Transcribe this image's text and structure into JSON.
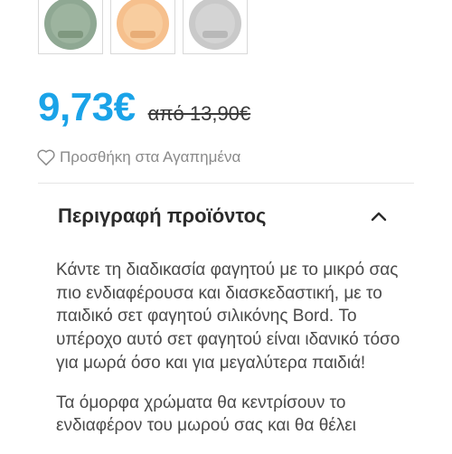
{
  "swatches": [
    {
      "name": "green",
      "color": "#8fa893"
    },
    {
      "name": "orange",
      "color": "#f6c08d"
    },
    {
      "name": "grey",
      "color": "#c9c9c9"
    }
  ],
  "price": {
    "current": "9,73€",
    "old": "από 13,90€"
  },
  "wishlist": {
    "label": "Προσθήκη στα Αγαπημένα"
  },
  "description": {
    "title": "Περιγραφή προϊόντος",
    "expanded": true,
    "paragraphs": [
      "Κάντε τη διαδικασία φαγητού με το μικρό σας πιο ενδιαφέρουσα και διασκεδαστική, με το παιδικό σετ φαγητού σιλικόνης Bord. Το υπέροχο αυτό σετ φαγητού είναι ιδανικό τόσο για μωρά όσο και για μεγαλύτερα παιδιά!",
      "Τα όμορφα χρώματα θα κεντρίσουν το ενδιαφέρον του μωρού σας και θα θέλει"
    ]
  },
  "colors": {
    "accent_price": "#1aa3e8",
    "text": "#4a4a4a",
    "muted": "#8a8a8a"
  }
}
